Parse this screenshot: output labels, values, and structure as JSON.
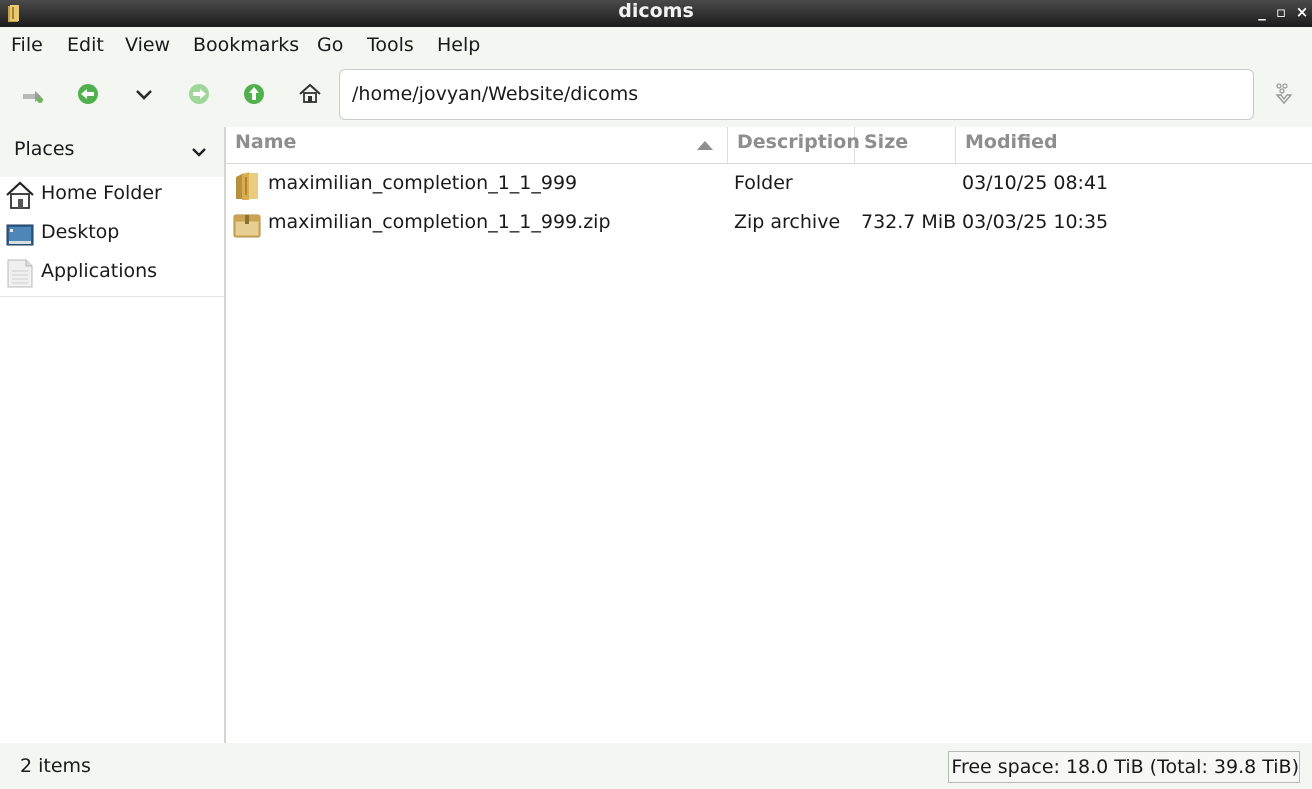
{
  "window": {
    "title": "dicoms",
    "minimize": "_",
    "maximize": "▫",
    "close": "×"
  },
  "menu": [
    "File",
    "Edit",
    "View",
    "Bookmarks",
    "Go",
    "Tools",
    "Help"
  ],
  "toolbar": {
    "location": "/home/jovyan/Website/dicoms"
  },
  "sidebar": {
    "header": "Places",
    "items": [
      {
        "label": "Home Folder",
        "icon": "home-icon"
      },
      {
        "label": "Desktop",
        "icon": "desktop-icon"
      },
      {
        "label": "Applications",
        "icon": "applications-icon"
      }
    ]
  },
  "filelist": {
    "columns": [
      "Name",
      "Description",
      "Size",
      "Modified"
    ],
    "rows": [
      {
        "name": "maximilian_completion_1_1_999",
        "description": "Folder",
        "size": "",
        "modified": "03/10/25 08:41",
        "icon": "folder-icon"
      },
      {
        "name": "maximilian_completion_1_1_999.zip",
        "description": "Zip archive",
        "size": "732.7 MiB",
        "modified": "03/03/25 10:35",
        "icon": "zip-archive-icon"
      }
    ]
  },
  "status": {
    "count": "2 items",
    "free_space": "Free space: 18.0 TiB (Total: 39.8 TiB)"
  }
}
